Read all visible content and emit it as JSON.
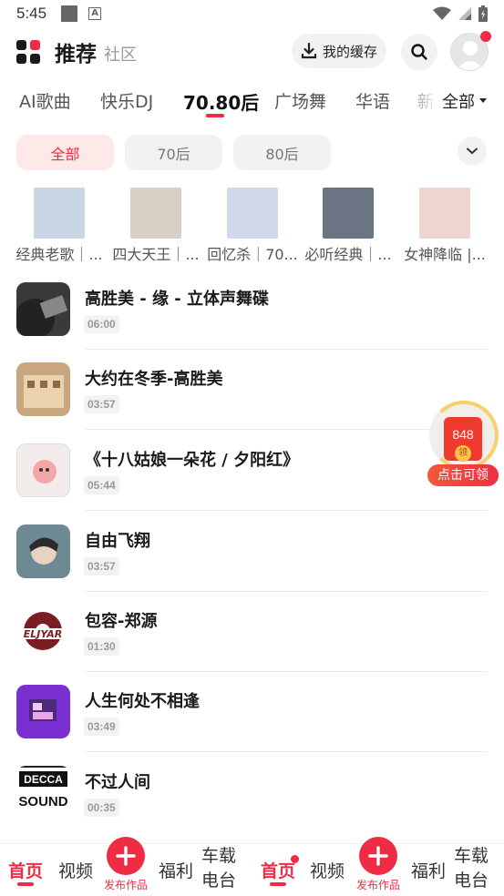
{
  "status_bar": {
    "time": "5:45",
    "a_label": "A"
  },
  "header": {
    "title": "推荐",
    "subtitle": "社区",
    "cache_label": "我的缓存"
  },
  "tabs": [
    {
      "label": "AI歌曲"
    },
    {
      "label": "快乐DJ"
    },
    {
      "label": "70.80后"
    },
    {
      "label": "广场舞"
    },
    {
      "label": "华语"
    },
    {
      "label": "新"
    }
  ],
  "tab_all_label": "全部",
  "chips": [
    {
      "label": "全部"
    },
    {
      "label": "70后"
    },
    {
      "label": "80后"
    }
  ],
  "playlists": [
    {
      "label": "经典老歌｜...",
      "color": "#c9d6e6"
    },
    {
      "label": "四大天王｜...",
      "color": "#d8cfc5"
    },
    {
      "label": "回忆杀｜70...",
      "color": "#cfd9ea"
    },
    {
      "label": "必听经典｜...",
      "color": "#6b7482"
    },
    {
      "label": "女神降临 |...",
      "color": "#efd5cf"
    }
  ],
  "songs": [
    {
      "title": "高胜美 - 缘 - 立体声舞碟",
      "duration": "06:00",
      "color": "#3a3a3a"
    },
    {
      "title": "大约在冬季-高胜美",
      "duration": "03:57",
      "color": "#c9a77e"
    },
    {
      "title": "《十八姑娘一朵花 / 夕阳红》",
      "duration": "05:44",
      "color": "#f4ecea"
    },
    {
      "title": "自由飞翔",
      "duration": "03:57",
      "color": "#6d8a92"
    },
    {
      "title": "包容-郑源",
      "duration": "01:30",
      "color": "#ffffff"
    },
    {
      "title": "人生何处不相逢",
      "duration": "03:49",
      "color": "#7a2fd0"
    },
    {
      "title": "不过人间",
      "duration": "00:35",
      "color": "#ffffff"
    }
  ],
  "song_logo_text": {
    "eljyar": "ELJYAR",
    "decca": "DECCA",
    "sound": "SOUND"
  },
  "redpack": {
    "amount": "848",
    "coin": "领",
    "cta": "点击可领"
  },
  "bottom_nav": {
    "home": "首页",
    "video": "视频",
    "publish": "发布作品",
    "welfare": "福利",
    "car_line1": "车载",
    "car_line2": "电台"
  },
  "colors": {
    "accent": "#f02c45",
    "chip_bg": "#f2f2f4",
    "active_chip_bg": "#ffe8e8"
  }
}
